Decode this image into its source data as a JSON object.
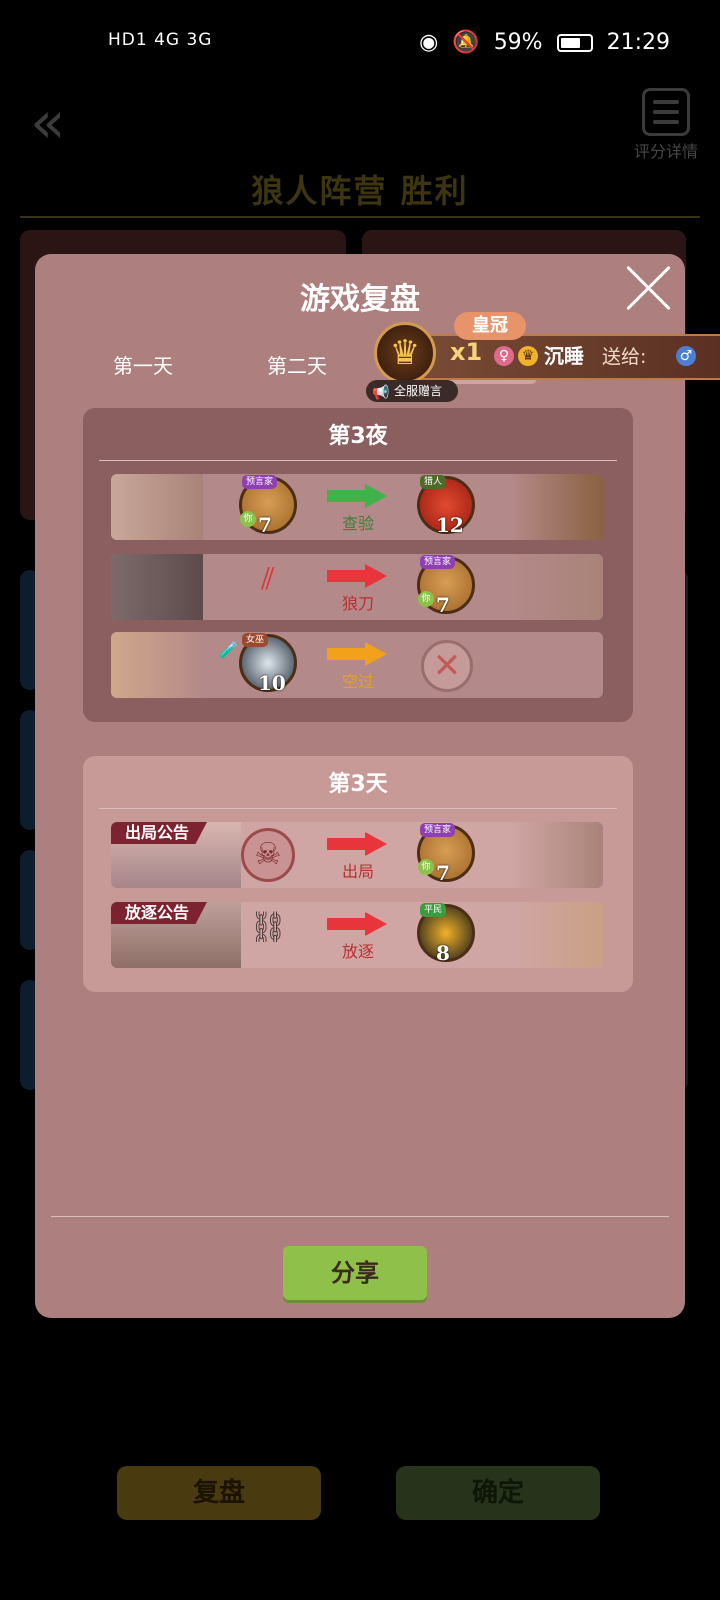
{
  "status_bar": {
    "left": "HD1 4G 3G",
    "battery": "59%",
    "time": "21:29"
  },
  "background_page": {
    "title": "狼人阵营  胜利",
    "detail_label": "评分详情",
    "replay_button": "复盘",
    "confirm_button": "确定"
  },
  "modal": {
    "title": "游戏复盘",
    "tabs": [
      "第一天",
      "第二天"
    ],
    "share_button": "分享"
  },
  "gift_banner": {
    "gift_name": "皇冠",
    "count": "x1",
    "recipient": "沉睡",
    "send_label": "送给:",
    "badge": "全服赠言"
  },
  "night": {
    "title": "第3夜",
    "rows": [
      {
        "role_tag": "预言家",
        "you": "你",
        "actor_num": "7",
        "action": "查验",
        "target_role": "猎人",
        "target_num": "12"
      },
      {
        "action": "狼刀",
        "target_role": "预言家",
        "target_you": "你",
        "target_num": "7"
      },
      {
        "actor_role": "女巫",
        "actor_num": "10",
        "action": "空过"
      }
    ]
  },
  "day": {
    "title": "第3天",
    "rows": [
      {
        "banner": "出局公告",
        "action": "出局",
        "target_role": "预言家",
        "target_you": "你",
        "target_num": "7"
      },
      {
        "banner": "放逐公告",
        "action": "放逐",
        "target_role": "平民",
        "target_num": "8"
      }
    ]
  },
  "colors": {
    "accent_green": "#8fc04a",
    "arrow_green": "#3fb34a",
    "arrow_red": "#e8353b",
    "arrow_orange": "#f2a11b"
  }
}
